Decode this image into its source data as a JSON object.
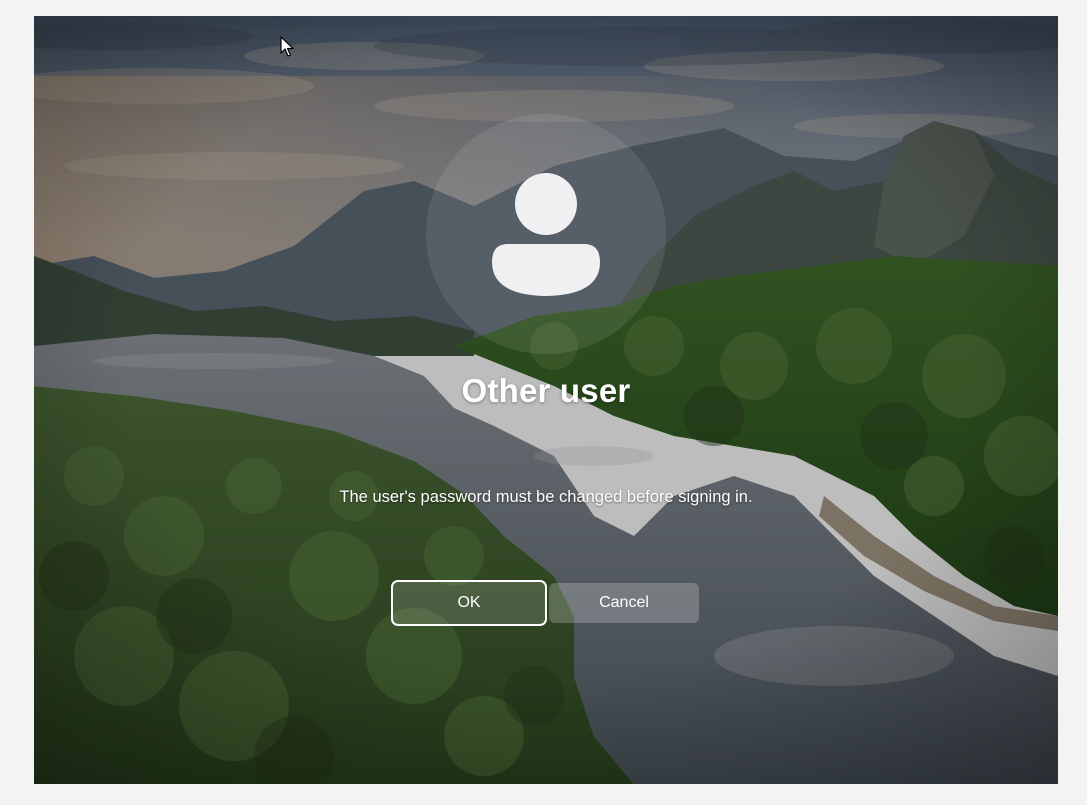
{
  "login": {
    "user_name": "Other user",
    "message": "The user's password must be changed before signing in.",
    "ok_label": "OK",
    "cancel_label": "Cancel"
  },
  "icons": {
    "avatar": "user-avatar-icon",
    "cursor": "mouse-pointer-icon"
  },
  "colors": {
    "text": "#ffffff",
    "desktop_border": "#f3f3f3"
  }
}
